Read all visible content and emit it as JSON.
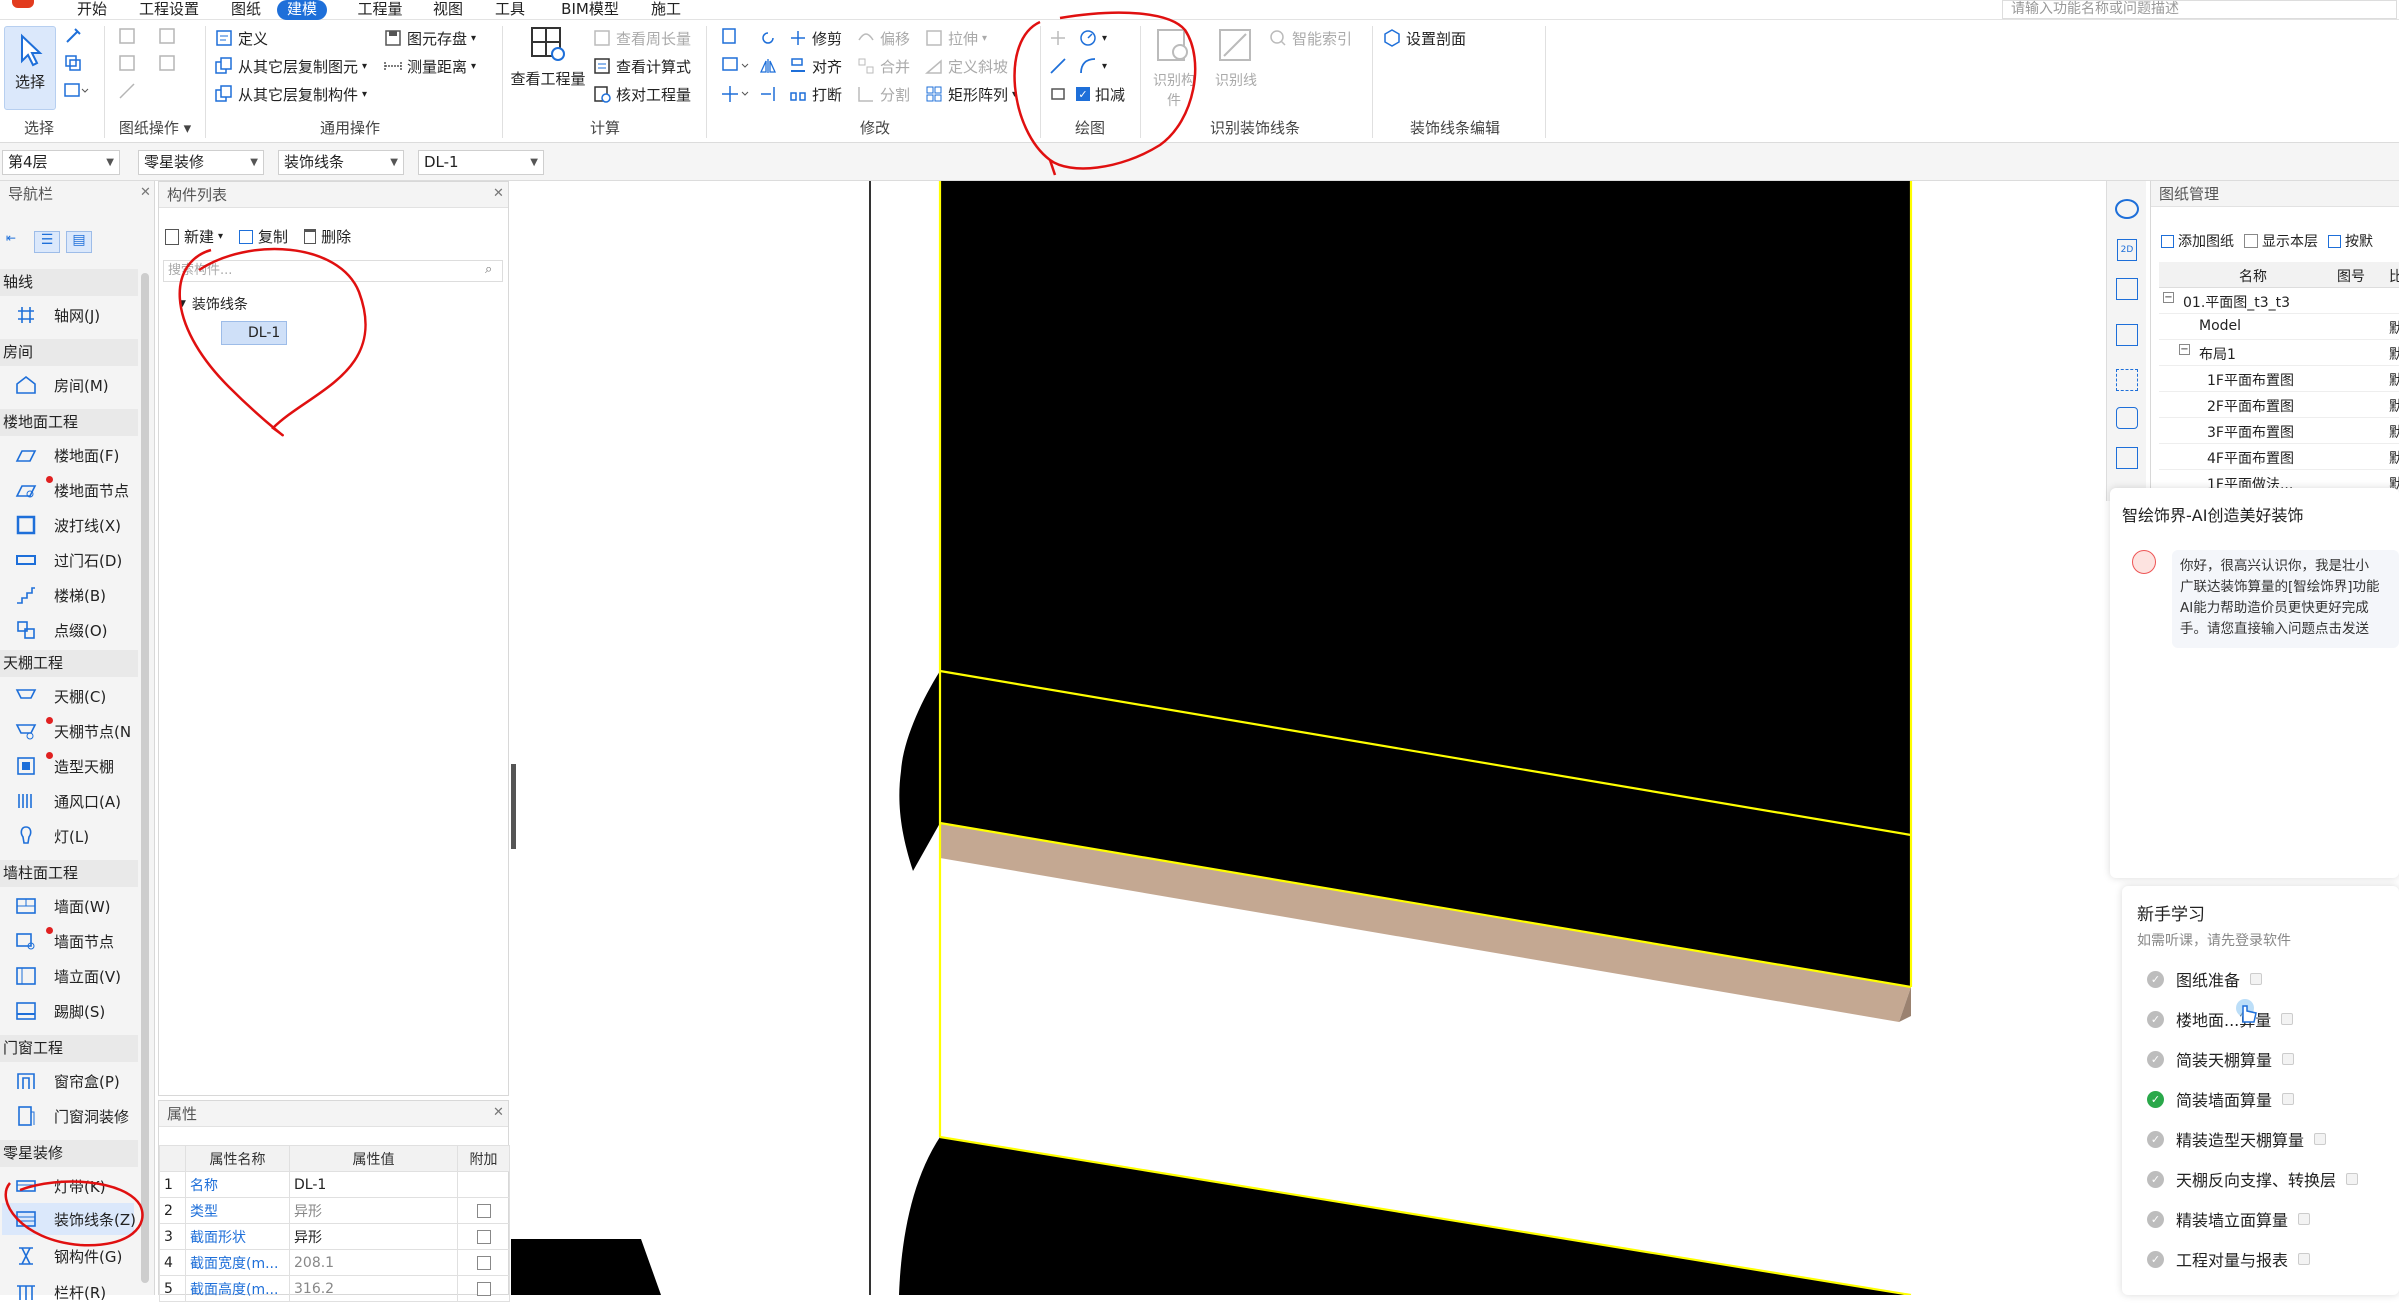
{
  "menu": {
    "items": [
      "开始",
      "工程设置",
      "图纸",
      "建模",
      "工程量",
      "视图",
      "工具",
      "BIM模型",
      "施工"
    ],
    "active": "建模",
    "search_placeholder": "请输入功能名称或问题描述"
  },
  "ribbon": {
    "select": {
      "label": "选择",
      "group": "选择"
    },
    "drawing_ops": {
      "group": "图纸操作 ▾"
    },
    "common": {
      "define": "定义",
      "copy_from_layer": "从其它层复制图元",
      "copy_to_layer": "从其它层复制构件",
      "element_save": "图元存盘",
      "measure_distance": "测量距离",
      "group": "通用操作"
    },
    "calc": {
      "view_quantity": "查看工程量",
      "view_perimeter": "查看周长量",
      "view_formula": "查看计算式",
      "check_quantity": "核对工程量",
      "group": "计算"
    },
    "modify": {
      "trim": "修剪",
      "align": "对齐",
      "break": "打断",
      "offset": "偏移",
      "merge": "合并",
      "split": "分割",
      "stretch": "拉伸",
      "define_slope": "定义斜坡",
      "rect_array": "矩形阵列",
      "group": "修改"
    },
    "draw": {
      "deduct": "扣减",
      "group": "绘图"
    },
    "identify": {
      "identify_component": "识别构件",
      "identify_line": "识别线",
      "smart_index": "智能索引",
      "group": "识别装饰线条"
    },
    "edit": {
      "set_section": "设置剖面",
      "group": "装饰线条编辑"
    }
  },
  "selectors": {
    "floor": "第4层",
    "category": "零星装修",
    "type": "装饰线条",
    "component": "DL-1"
  },
  "nav": {
    "title": "导航栏",
    "categories": [
      {
        "name": "轴线",
        "items": [
          "轴网(J)"
        ]
      },
      {
        "name": "房间",
        "items": [
          "房间(M)"
        ]
      },
      {
        "name": "楼地面工程",
        "items": [
          "楼地面(F)",
          "楼地面节点",
          "波打线(X)",
          "过门石(D)",
          "楼梯(B)",
          "点缀(O)"
        ]
      },
      {
        "name": "天棚工程",
        "items": [
          "天棚(C)",
          "天棚节点(N",
          "造型天棚",
          "通风口(A)",
          "灯(L)"
        ]
      },
      {
        "name": "墙柱面工程",
        "items": [
          "墙面(W)",
          "墙面节点",
          "墙立面(V)",
          "踢脚(S)"
        ]
      },
      {
        "name": "门窗工程",
        "items": [
          "窗帘盒(P)",
          "门窗洞装修"
        ]
      },
      {
        "name": "零星装修",
        "items": [
          "灯带(K)",
          "装饰线条(Z)",
          "钢构件(G)",
          "栏杆(R)"
        ]
      }
    ]
  },
  "component_list": {
    "title": "构件列表",
    "new": "新建",
    "copy": "复制",
    "delete": "删除",
    "search_placeholder": "搜索构件...",
    "tree_root": "装饰线条",
    "tree_child": "DL-1"
  },
  "properties": {
    "title": "属性",
    "headers": [
      "属性名称",
      "属性值",
      "附加"
    ],
    "rows": [
      {
        "no": "1",
        "name": "名称",
        "value": "DL-1"
      },
      {
        "no": "2",
        "name": "类型",
        "value": "异形"
      },
      {
        "no": "3",
        "name": "截面形状",
        "value": "异形"
      },
      {
        "no": "4",
        "name": "截面宽度(m...",
        "value": "208.1"
      },
      {
        "no": "5",
        "name": "截面高度(m...",
        "value": "316.2"
      }
    ]
  },
  "drawing_manager": {
    "title": "图纸管理",
    "add": "添加图纸",
    "show_layer": "显示本层",
    "search": "按默",
    "col_name": "名称",
    "col_no": "图号",
    "col_ratio": "比",
    "rows": [
      {
        "name": "01.平面图_t3_t3",
        "extra": ""
      },
      {
        "name": "Model",
        "extra": "默"
      },
      {
        "name": "布局1",
        "extra": "默"
      },
      {
        "name": "1F平面布置图",
        "extra": "默"
      },
      {
        "name": "2F平面布置图",
        "extra": "默"
      },
      {
        "name": "3F平面布置图",
        "extra": "默"
      },
      {
        "name": "4F平面布置图",
        "extra": "默"
      },
      {
        "name": "1F平面做法...",
        "extra": "默"
      }
    ]
  },
  "ai_panel": {
    "title": "智绘饰界-AI创造美好装饰",
    "message": [
      "你好，很高兴认识你，我是壮小",
      "广联达装饰算量的[智绘饰界]功能",
      "AI能力帮助造价员更快更好完成",
      "手。请您直接输入问题点击发送"
    ]
  },
  "learning": {
    "title": "新手学习",
    "subtitle": "如需听课，请先登录软件",
    "items": [
      {
        "label": "图纸准备",
        "done": false
      },
      {
        "label": "楼地面...算量",
        "done": false
      },
      {
        "label": "简装天棚算量",
        "done": false
      },
      {
        "label": "简装墙面算量",
        "done": true
      },
      {
        "label": "精装造型天棚算量",
        "done": false
      },
      {
        "label": "天棚反向支撑、转换层",
        "done": false
      },
      {
        "label": "精装墙立面算量",
        "done": false
      },
      {
        "label": "工程对量与报表",
        "done": false
      }
    ]
  },
  "colors": {
    "accent": "#1e6fd9",
    "annotation": "#e01010",
    "edge": "#ffff00",
    "molding": "#c4a892"
  }
}
